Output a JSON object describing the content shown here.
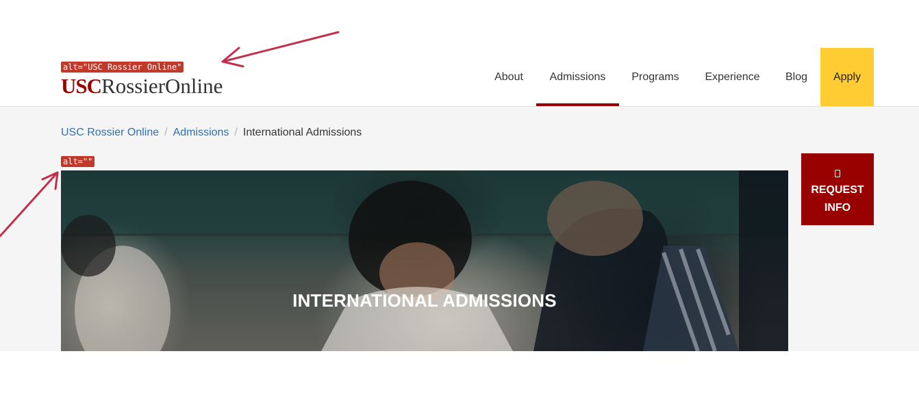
{
  "header": {
    "logo": {
      "usc": "USC",
      "rest": "RossierOnline"
    },
    "nav": [
      {
        "label": "About"
      },
      {
        "label": "Admissions"
      },
      {
        "label": "Programs"
      },
      {
        "label": "Experience"
      },
      {
        "label": "Blog"
      },
      {
        "label": "Apply"
      }
    ]
  },
  "breadcrumb": {
    "home": "USC Rossier Online",
    "sep1": "/",
    "section": "Admissions",
    "sep2": "/",
    "current": "International Admissions"
  },
  "hero": {
    "title": "INTERNATIONAL ADMISSIONS"
  },
  "request_info": {
    "icon": "mobile-phone-icon",
    "line1": "REQUEST",
    "line2": "INFO"
  },
  "annotations": {
    "logo_alt": "alt=\"USC Rossier Online\"",
    "hero_alt": "alt=\"\""
  },
  "colors": {
    "brand_red": "#990000",
    "apply_yellow": "#ffcc33",
    "link_blue": "#2d6fad",
    "annotation_red": "#c0392b"
  }
}
